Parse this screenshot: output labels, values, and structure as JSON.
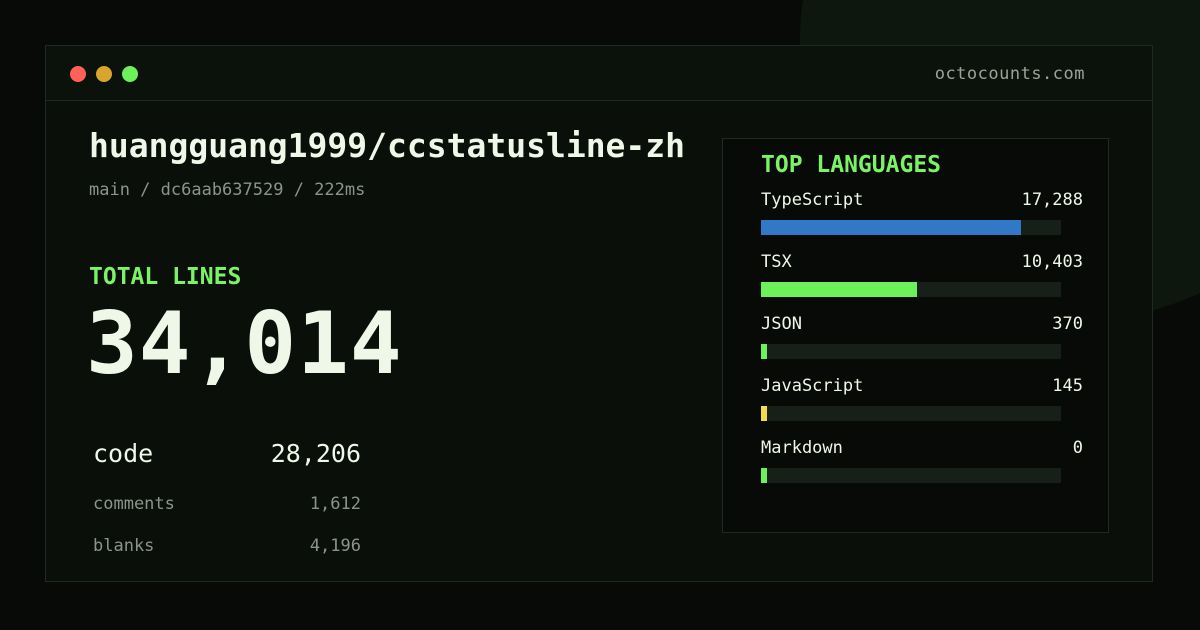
{
  "window": {
    "site": "octocounts.com"
  },
  "repo": {
    "name": "huangguang1999/ccstatusline-zh",
    "meta": "main / dc6aab637529 / 222ms"
  },
  "totals": {
    "label": "TOTAL LINES",
    "value": "34,014",
    "code_label": "code",
    "code_value": "28,206",
    "comments_label": "comments",
    "comments_value": "1,612",
    "blanks_label": "blanks",
    "blanks_value": "4,196"
  },
  "languages": {
    "title": "TOP LANGUAGES",
    "items": [
      {
        "name": "TypeScript",
        "count": "17,288",
        "share": 0.867,
        "color": "#3178c6"
      },
      {
        "name": "TSX",
        "count": "10,403",
        "share": 0.52,
        "color": "#6ef05a"
      },
      {
        "name": "JSON",
        "count": "370",
        "share": 0.02,
        "color": "#6ef05a"
      },
      {
        "name": "JavaScript",
        "count": "145",
        "share": 0.02,
        "color": "#f1dc50"
      },
      {
        "name": "Markdown",
        "count": "0",
        "share": 0.02,
        "color": "#6ef05a"
      }
    ]
  }
}
